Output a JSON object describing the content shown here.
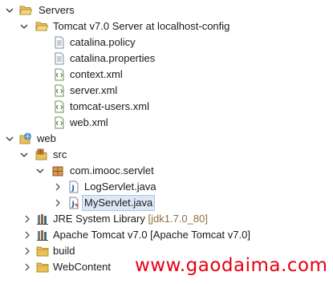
{
  "tree": {
    "servers": {
      "label": "Servers",
      "icon": "folder-open-icon",
      "expanded": true
    },
    "tomcat_config": {
      "label": "Tomcat v7.0 Server at localhost-config",
      "icon": "folder-open-icon",
      "expanded": true
    },
    "files": [
      {
        "label": "catalina.policy",
        "icon": "text-file-icon"
      },
      {
        "label": "catalina.properties",
        "icon": "text-file-icon"
      },
      {
        "label": "context.xml",
        "icon": "xml-file-icon"
      },
      {
        "label": "server.xml",
        "icon": "xml-file-icon"
      },
      {
        "label": "tomcat-users.xml",
        "icon": "xml-file-icon"
      },
      {
        "label": "web.xml",
        "icon": "xml-file-icon"
      }
    ],
    "web": {
      "label": "web",
      "icon": "web-project-icon",
      "expanded": true
    },
    "src": {
      "label": "src",
      "icon": "source-folder-icon",
      "expanded": true
    },
    "package": {
      "label": "com.imooc.servlet",
      "icon": "package-icon",
      "expanded": true
    },
    "classes": [
      {
        "label": "LogServlet.java",
        "icon": "java-file-icon",
        "selected": false
      },
      {
        "label": "MyServlet.java",
        "icon": "java-file-icon",
        "selected": true
      }
    ],
    "jre": {
      "label": "JRE System Library",
      "decoration": "[jdk1.7.0_80]",
      "icon": "library-icon",
      "expanded": false
    },
    "tomcat_lib": {
      "label": "Apache Tomcat v7.0 [Apache Tomcat v7.0]",
      "icon": "library-icon",
      "expanded": false
    },
    "build": {
      "label": "build",
      "icon": "folder-icon",
      "expanded": false
    },
    "webcontent": {
      "label": "WebContent",
      "icon": "folder-icon",
      "expanded": false
    }
  },
  "watermark": {
    "text": "www.gaodaima.com"
  },
  "colors": {
    "selection": "#dbe9f7",
    "decoration": "#946f3f",
    "watermark": "#e60012",
    "folder": "#e8c15a"
  }
}
